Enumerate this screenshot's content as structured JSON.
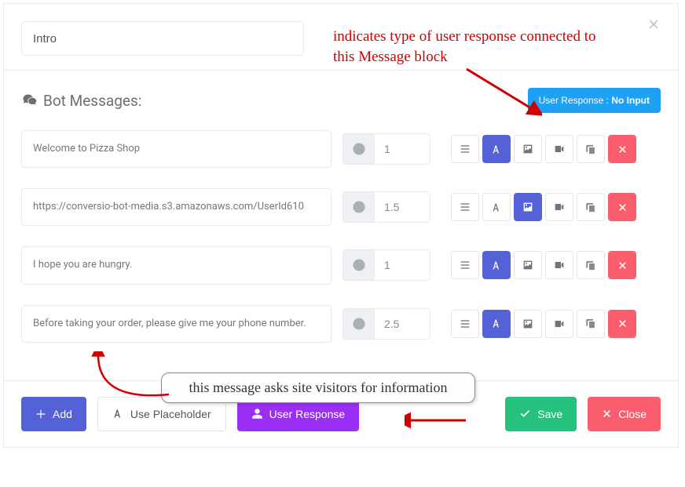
{
  "title_value": "Intro",
  "section_title": "Bot Messages:",
  "user_response_badge_prefix": "User Response : ",
  "user_response_badge_value": "No Input",
  "rows": [
    {
      "text": "Welcome to Pizza Shop",
      "delay": "1",
      "active_tool": "text"
    },
    {
      "text": "https://conversio-bot-media.s3.amazonaws.com/UserId610",
      "delay": "1.5",
      "active_tool": "image"
    },
    {
      "text": "I hope you are hungry.",
      "delay": "1",
      "active_tool": "text"
    },
    {
      "text": "Before taking your order, please give me your phone number.",
      "delay": "2.5",
      "active_tool": "text"
    }
  ],
  "footer": {
    "add": "Add",
    "placeholder": "Use Placeholder",
    "user_response": "User Response",
    "save": "Save",
    "close": "Close"
  },
  "annotations": {
    "top": "indicates type of user response connected to this Message block",
    "bottom": "this message asks site visitors for information"
  }
}
